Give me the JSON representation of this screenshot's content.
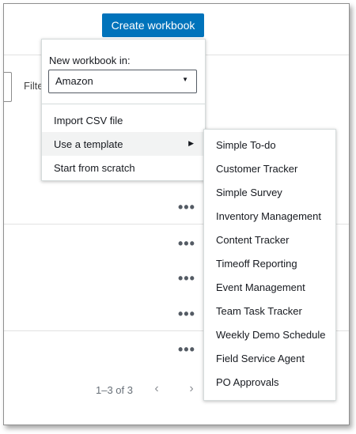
{
  "header": {
    "create_button_label": "Create workbook"
  },
  "toolbar": {
    "filter_text": "Filte"
  },
  "menu": {
    "label": "New workbook in:",
    "account_select": {
      "value": "Amazon"
    },
    "items": [
      {
        "label": "Import CSV file"
      },
      {
        "label": "Use a template"
      },
      {
        "label": "Start from scratch"
      }
    ]
  },
  "template_submenu": {
    "items": [
      {
        "label": "Simple To-do"
      },
      {
        "label": "Customer Tracker"
      },
      {
        "label": "Simple Survey"
      },
      {
        "label": "Inventory Management"
      },
      {
        "label": "Content Tracker"
      },
      {
        "label": "Timeoff Reporting"
      },
      {
        "label": "Event Management"
      },
      {
        "label": "Team Task Tracker"
      },
      {
        "label": "Weekly Demo Schedule"
      },
      {
        "label": "Field Service Agent"
      },
      {
        "label": "PO Approvals"
      }
    ]
  },
  "row_actions": {
    "ellipsis": "•••"
  },
  "pagination": {
    "range_text": "1–3 of 3",
    "prev_symbol": "‹",
    "next_symbol": "›"
  }
}
